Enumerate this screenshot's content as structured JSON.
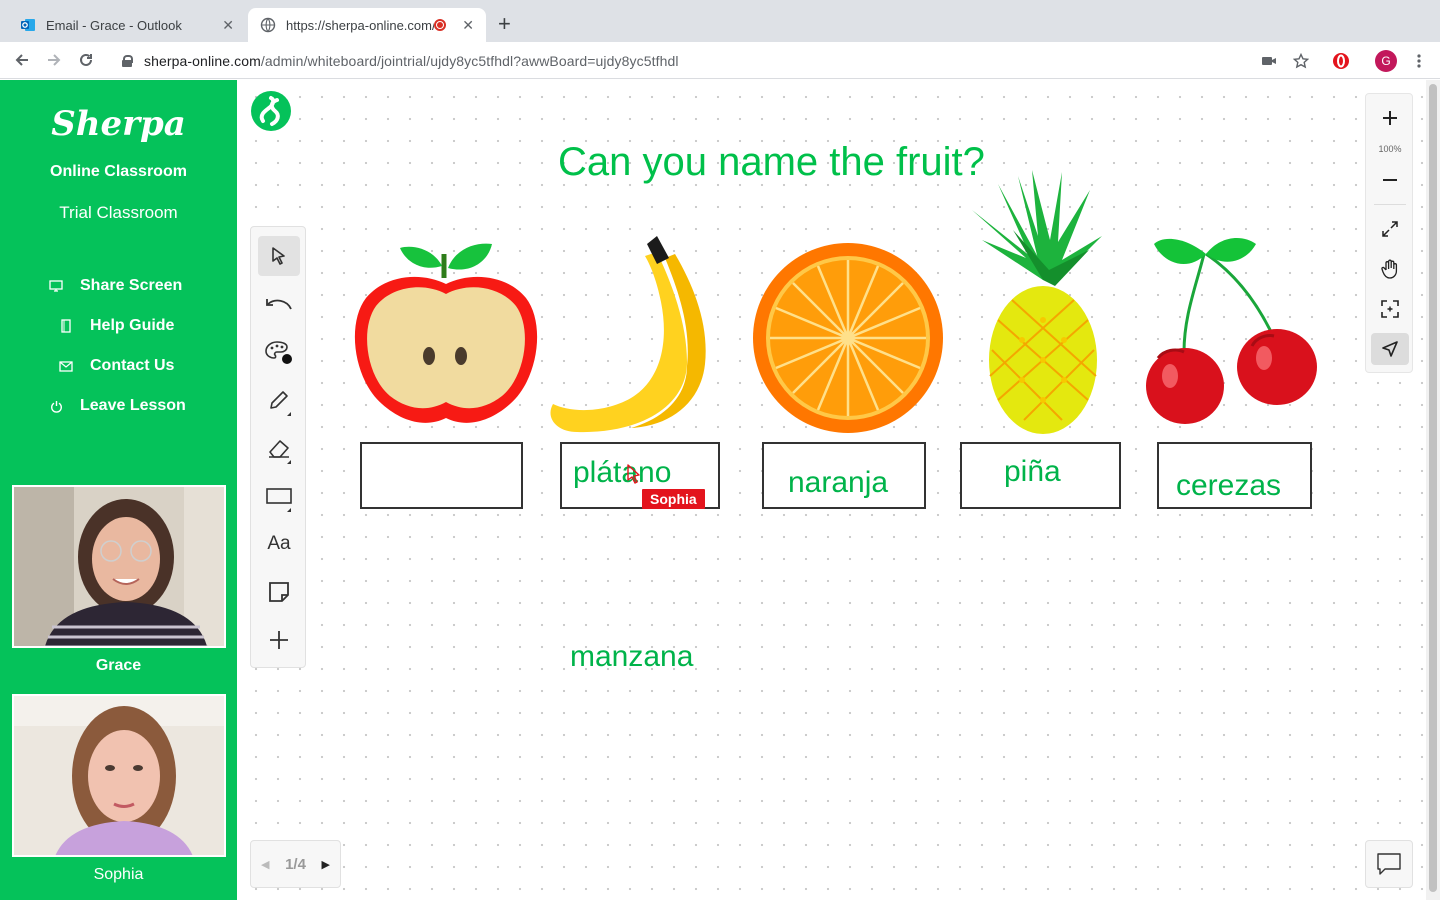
{
  "browser": {
    "tabs": [
      {
        "title": "Email - Grace - Outlook",
        "close": "✕"
      },
      {
        "title": "https://sherpa-online.com/",
        "close": "✕"
      }
    ],
    "url_host": "sherpa-online.com",
    "url_path": "/admin/whiteboard/jointrial/ujdy8yc5tfhdl?awwBoard=ujdy8yc5tfhdl",
    "profile_initial": "G"
  },
  "sidebar": {
    "logo": "Sherpa",
    "subtitle": "Online Classroom",
    "classroom": "Trial Classroom",
    "menu": [
      {
        "label": "Share Screen",
        "icon": "monitor-icon"
      },
      {
        "label": "Help Guide",
        "icon": "book-icon"
      },
      {
        "label": "Contact Us",
        "icon": "mail-icon"
      },
      {
        "label": "Leave Lesson",
        "icon": "power-icon"
      }
    ],
    "participants": [
      {
        "name": "Grace"
      },
      {
        "name": "Sophia"
      }
    ]
  },
  "board": {
    "title": "Can you name the fruit?",
    "fruits": [
      "apple",
      "banana",
      "orange",
      "pineapple",
      "cherries"
    ],
    "answers": [
      "",
      "plátano",
      "naranja",
      "piña",
      "cerezas"
    ],
    "loose_word": "manzana",
    "cursor_user": "Sophia",
    "zoom_level": "100%",
    "page": "1/4",
    "colors": {
      "accent": "#05c25a",
      "text_green": "#00b34a",
      "cursor_red": "#e3141d"
    }
  }
}
